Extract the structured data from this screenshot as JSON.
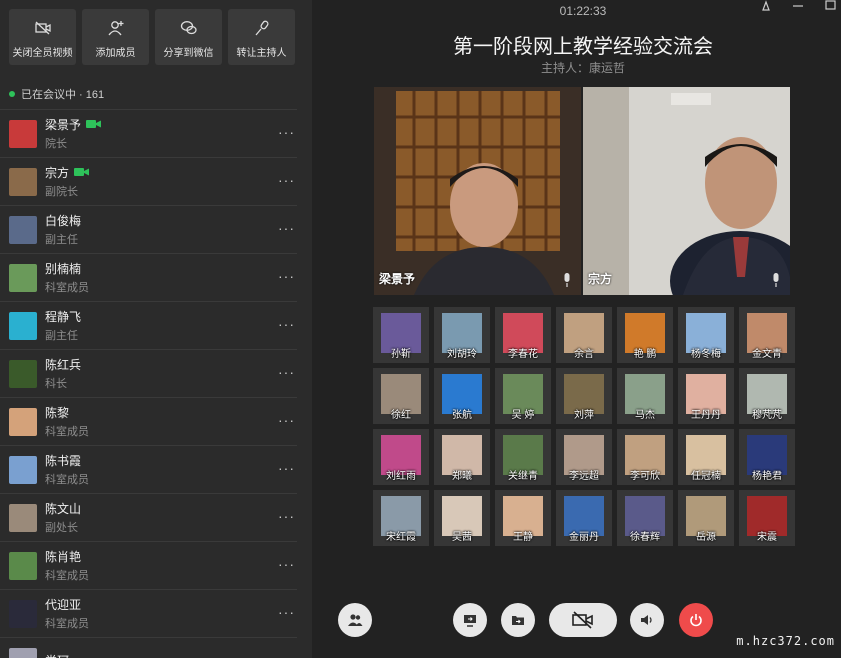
{
  "sidebar": {
    "actions": [
      {
        "label": "关闭全员视频",
        "icon": "video-off-icon"
      },
      {
        "label": "添加成员",
        "icon": "add-user-icon"
      },
      {
        "label": "分享到微信",
        "icon": "wechat-icon"
      },
      {
        "label": "转让主持人",
        "icon": "microphone-icon"
      }
    ],
    "online_text": "已在会议中 · 161",
    "members": [
      {
        "name": "梁景予",
        "role": "院长",
        "camera": true,
        "color": "#c83a3a"
      },
      {
        "name": "宗方",
        "role": "副院长",
        "camera": true,
        "color": "#8a6a4a"
      },
      {
        "name": "白俊梅",
        "role": "副主任",
        "camera": false,
        "color": "#5a6a8a"
      },
      {
        "name": "别楠楠",
        "role": "科室成员",
        "camera": false,
        "color": "#6a9a5a"
      },
      {
        "name": "程静飞",
        "role": "副主任",
        "camera": false,
        "color": "#2ab0d0"
      },
      {
        "name": "陈红兵",
        "role": "科长",
        "camera": false,
        "color": "#3a5a2a"
      },
      {
        "name": "陈黎",
        "role": "科室成员",
        "camera": false,
        "color": "#d4a27a"
      },
      {
        "name": "陈书霞",
        "role": "科室成员",
        "camera": false,
        "color": "#7aa0d0"
      },
      {
        "name": "陈文山",
        "role": "副处长",
        "camera": false,
        "color": "#9a8a7a"
      },
      {
        "name": "陈肖艳",
        "role": "科室成员",
        "camera": false,
        "color": "#5a8a4a"
      },
      {
        "name": "代迎亚",
        "role": "科室成员",
        "camera": false,
        "color": "#2a2a3a"
      },
      {
        "name": "党珂",
        "role": "",
        "camera": false,
        "color": "#a0a0b0"
      }
    ]
  },
  "meeting": {
    "timer": "01:22:33",
    "title": "第一阶段网上教学经验交流会",
    "host_text": "主持人：康运哲",
    "videos": [
      {
        "name": "梁景予"
      },
      {
        "name": "宗方"
      }
    ],
    "participants": [
      {
        "name": "孙靳",
        "color": "#6a5a9a"
      },
      {
        "name": "刘胡玲",
        "color": "#7a9ab0"
      },
      {
        "name": "李春花",
        "color": "#d04a5a"
      },
      {
        "name": "余言",
        "color": "#c0a080"
      },
      {
        "name": "艳 鹏",
        "color": "#d07a2a"
      },
      {
        "name": "杨冬梅",
        "color": "#8ab0d8"
      },
      {
        "name": "金文青",
        "color": "#c08a6a"
      },
      {
        "name": "徐红",
        "color": "#9a8a7a"
      },
      {
        "name": "张航",
        "color": "#2a7ad0"
      },
      {
        "name": "吴 婷",
        "color": "#6a8a5a"
      },
      {
        "name": "刘萍",
        "color": "#7a6a4a"
      },
      {
        "name": "马杰",
        "color": "#8aa08a"
      },
      {
        "name": "王丹丹",
        "color": "#e0b0a0"
      },
      {
        "name": "穆芃芃",
        "color": "#b0b8b0"
      },
      {
        "name": "刘红雨",
        "color": "#c04a8a"
      },
      {
        "name": "郑曦",
        "color": "#d0b8a8"
      },
      {
        "name": "关继青",
        "color": "#5a7a4a"
      },
      {
        "name": "李远超",
        "color": "#b09a8a"
      },
      {
        "name": "李可欣",
        "color": "#c0a080"
      },
      {
        "name": "任冠楠",
        "color": "#d8c0a0"
      },
      {
        "name": "杨艳君",
        "color": "#2a3a7a"
      },
      {
        "name": "宋红霞",
        "color": "#8a9aa8"
      },
      {
        "name": "吴茜",
        "color": "#d8c8b8"
      },
      {
        "name": "王静",
        "color": "#d8b090"
      },
      {
        "name": "金丽丹",
        "color": "#3a6ab0"
      },
      {
        "name": "徐春辉",
        "color": "#5a5a8a"
      },
      {
        "name": "岳源",
        "color": "#b09a7a"
      },
      {
        "name": "宋震",
        "color": "#a02a2a"
      }
    ]
  },
  "controls": [
    {
      "icon": "participants-icon"
    },
    {
      "icon": "share-screen-icon"
    },
    {
      "icon": "share-file-icon"
    },
    {
      "icon": "video-off-icon"
    },
    {
      "icon": "speaker-icon"
    },
    {
      "icon": "power-icon"
    }
  ],
  "watermark": "m.hzc372.com"
}
